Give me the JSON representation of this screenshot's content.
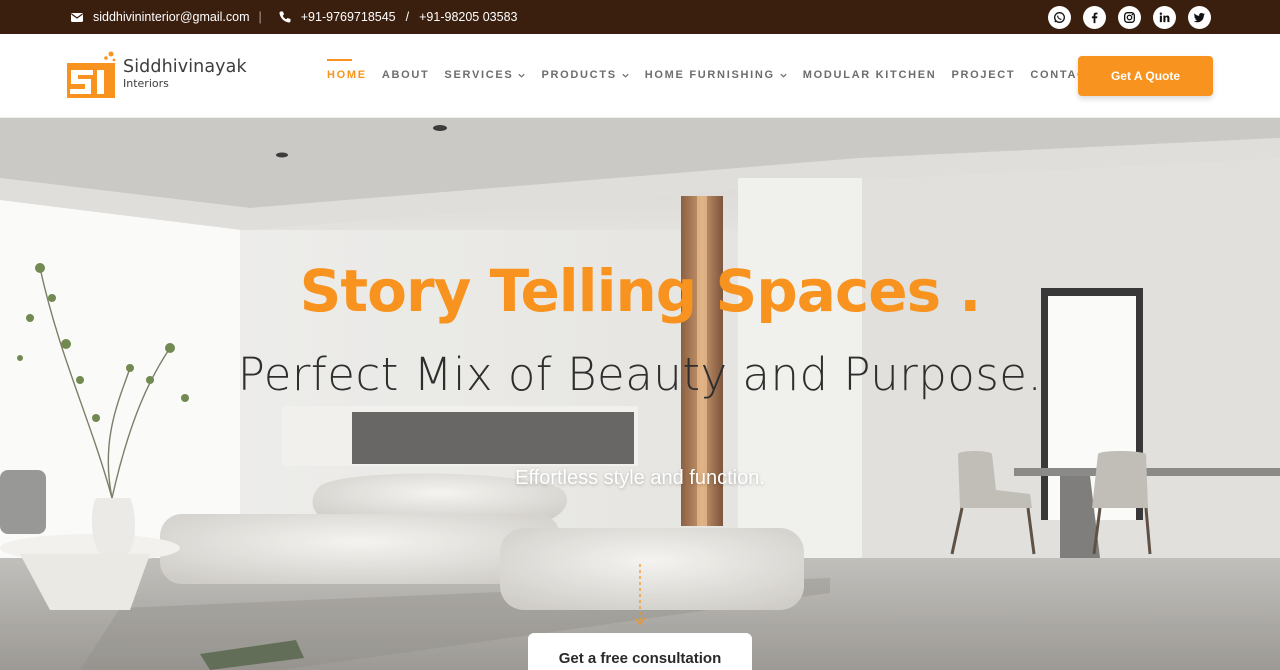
{
  "topbar": {
    "email": "siddhivininterior@gmail.com",
    "separator": "|",
    "phone1": "+91-9769718545",
    "phone_separator": "/",
    "phone2": "+91-98205 03583",
    "social_icons": [
      "whatsapp-icon",
      "facebook-icon",
      "instagram-icon",
      "linkedin-icon",
      "twitter-icon"
    ]
  },
  "brand": {
    "name": "Siddhivinayak",
    "sub": "Interiors",
    "mark": "SI"
  },
  "nav": {
    "home": "HOME",
    "about": "ABOUT",
    "services": "SERVICES",
    "products": "PRODUCTS",
    "home_furnishing": "HOME FURNISHING",
    "modular_kitchen": "MODULAR KITCHEN",
    "project": "PROJECT",
    "contact": "CONTACT",
    "active": "HOME"
  },
  "header": {
    "quote_label": "Get A Quote"
  },
  "hero": {
    "title": "Story Telling Spaces .",
    "subtitle": "Perfect Mix of Beauty and Purpose.",
    "tagline": "Effortless style and function.",
    "cta_label": "Get a free consultation"
  },
  "colors": {
    "accent": "#f7931e",
    "topbar": "#3a1f0f",
    "nav_text": "#6d6d6d"
  }
}
